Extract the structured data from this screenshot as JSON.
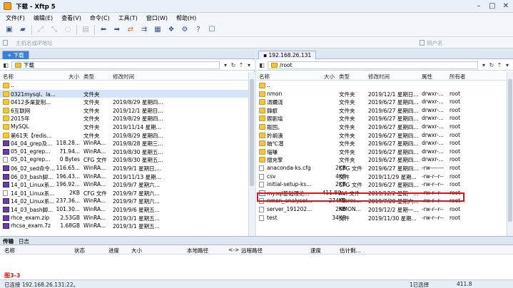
{
  "window": {
    "title": "下载 - Xftp 5"
  },
  "menu": [
    "文件(F)",
    "编辑(E)",
    "查看(V)",
    "命令(C)",
    "工具(T)",
    "窗口(W)",
    "帮助(H)"
  ],
  "address": {
    "host_placeholder": "主机名或IP地址",
    "user_placeholder": "用户名"
  },
  "local": {
    "tab": "下载",
    "path": "下载",
    "columns": {
      "name": "名称",
      "size": "大小",
      "type": "类型",
      "modified": "修改时间"
    },
    "rows": [
      {
        "icon": "up",
        "name": "..",
        "size": "",
        "type": "",
        "modified": ""
      },
      {
        "icon": "dir",
        "name": "0321mysql、la...",
        "size": "",
        "type": "文件夹",
        "modified": ""
      },
      {
        "icon": "dir",
        "name": "0412多渠复制...",
        "size": "",
        "type": "文件夹",
        "modified": "2019/8/29 星期四..."
      },
      {
        "icon": "dir",
        "name": "6互联网",
        "size": "",
        "type": "文件夹",
        "modified": "2019/12/1 星期日..."
      },
      {
        "icon": "dir",
        "name": "2015年",
        "size": "",
        "type": "文件夹",
        "modified": "2019/8/29 星期四..."
      },
      {
        "icon": "dir",
        "name": "MySQL",
        "size": "",
        "type": "文件夹",
        "modified": "2019/11/14 星期..."
      },
      {
        "icon": "dir",
        "name": "第61天【redis...",
        "size": "",
        "type": "文件夹",
        "modified": "2019/8/29 星期四..."
      },
      {
        "icon": "rar",
        "name": "04_04_grep及...",
        "size": "118.28...",
        "type": "WinRA...",
        "modified": "2019/8/28 星期三..."
      },
      {
        "icon": "rar",
        "name": "05_01_egrep...",
        "size": "71.94...",
        "type": "WinRA...",
        "modified": "2019/8/30 星期五..."
      },
      {
        "icon": "file",
        "name": "05_01_egrep...",
        "size": "0 Bytes",
        "type": "CFG 文件",
        "modified": "2019/8/30 星期五..."
      },
      {
        "icon": "rar",
        "name": "06_02_sed命令...",
        "size": "116.65...",
        "type": "WinRA...",
        "modified": "2019/9/1 星期日,..."
      },
      {
        "icon": "rar",
        "name": "06_03_bash脚...",
        "size": "196.43...",
        "type": "WinRA...",
        "modified": "2019/11/13 星期..."
      },
      {
        "icon": "rar",
        "name": "14_01_Linux系...",
        "size": "196.92...",
        "type": "WinRA...",
        "modified": "2019/9/7 星期六..."
      },
      {
        "icon": "file",
        "name": "14_01_Linux系...",
        "size": "2KB",
        "type": "CFG 文件",
        "modified": "2019/9/7 星期六..."
      },
      {
        "icon": "rar",
        "name": "14_02_Linux系...",
        "size": "237.36...",
        "type": "WinRA...",
        "modified": "2019/9/7 星期六..."
      },
      {
        "icon": "rar",
        "name": "14_03_bash脚...",
        "size": "101.30...",
        "type": "WinRA...",
        "modified": "2019/9/6 星期五..."
      },
      {
        "icon": "rar",
        "name": "rhce_exam.zip",
        "size": "2.53GB",
        "type": "WinRA...",
        "modified": "2019/3/1 星期五..."
      },
      {
        "icon": "rar",
        "name": "rhcsa_exam.7z",
        "size": "1.68GB",
        "type": "WinRA...",
        "modified": "2019/3/1 星期五..."
      }
    ]
  },
  "remote": {
    "tab": "192.168.26.131",
    "path": "/root",
    "columns": {
      "name": "名称",
      "size": "大小",
      "type": "类型",
      "modified": "修改时间",
      "perm": "属性",
      "owner": "所有者"
    },
    "rows": [
      {
        "icon": "up",
        "name": "..",
        "size": "",
        "type": "",
        "modified": "",
        "perm": "",
        "owner": ""
      },
      {
        "icon": "dir",
        "name": "nmon",
        "size": "",
        "type": "文件夹",
        "modified": "2019/12/1 星期日...",
        "perm": "drwxr-...",
        "owner": "root"
      },
      {
        "icon": "dir",
        "name": "涓嬭浇",
        "size": "",
        "type": "文件夹",
        "modified": "2019/6/27 星期四...",
        "perm": "drwxr-...",
        "owner": "root"
      },
      {
        "icon": "dir",
        "name": "鍏叡",
        "size": "",
        "type": "文件夹",
        "modified": "2019/6/27 星期四...",
        "perm": "drwxr-...",
        "owner": "root"
      },
      {
        "icon": "dir",
        "name": "鍥剧墖",
        "size": "",
        "type": "文件夹",
        "modified": "2019/6/27 星期四...",
        "perm": "drwxr-...",
        "owner": "root"
      },
      {
        "icon": "dir",
        "name": "鏂囨。",
        "size": "",
        "type": "文件夹",
        "modified": "2019/6/27 星期四...",
        "perm": "drwxr-...",
        "owner": "root"
      },
      {
        "icon": "dir",
        "name": "妗岄潰",
        "size": "",
        "type": "文件夹",
        "modified": "2019/6/27 星期四...",
        "perm": "drwxr-...",
        "owner": "root"
      },
      {
        "icon": "dir",
        "name": "妯℃澘",
        "size": "",
        "type": "文件夹",
        "modified": "2019/6/27 星期四...",
        "perm": "drwxr-...",
        "owner": "root"
      },
      {
        "icon": "dir",
        "name": "瑙嗛",
        "size": "",
        "type": "文件夹",
        "modified": "2019/6/27 星期四...",
        "perm": "drwxr-...",
        "owner": "root"
      },
      {
        "icon": "dir",
        "name": "闊充箰",
        "size": "",
        "type": "文件夹",
        "modified": "2019/6/27 星期四...",
        "perm": "drwxr-...",
        "owner": "root"
      },
      {
        "icon": "file",
        "name": "anaconda-ks.cfg",
        "size": "2KB",
        "type": "CFG 文件",
        "modified": "2019/6/27 星期四...",
        "perm": "-rw-------",
        "owner": "root"
      },
      {
        "icon": "file",
        "name": "csv",
        "size": "4KB",
        "type": "文件",
        "modified": "2019/11/29 星期...",
        "perm": "-rw-r--r--",
        "owner": "root"
      },
      {
        "icon": "file",
        "name": "initial-setup-ks...",
        "size": "2KB",
        "type": "CFG 文件",
        "modified": "2019/6/27 星期四...",
        "perm": "-rw-r--r--",
        "owner": "root"
      },
      {
        "icon": "sql",
        "name": "mysql基础理论...",
        "size": "411.80...",
        "type": "AVI 文件",
        "modified": "2019/12/2 星期一...",
        "perm": "-rw-r--r--",
        "owner": "root"
      },
      {
        "icon": "file",
        "name": "nmon_analyser...",
        "size": "274KB",
        "type": "Micros...",
        "modified": "2019/7/20 星期六...",
        "perm": "-rw-r--r--",
        "owner": "root"
      },
      {
        "icon": "file",
        "name": "server_191202...",
        "size": "2KB",
        "type": "NMON...",
        "modified": "2019/12/2 星期一...",
        "perm": "-rw-r--r--",
        "owner": "root"
      },
      {
        "icon": "file",
        "name": "test",
        "size": "34KB",
        "type": "文件",
        "modified": "2019/11/30 星期...",
        "perm": "-rw-r--r--",
        "owner": "root"
      }
    ]
  },
  "transfer": {
    "tabs": [
      "传输",
      "日志"
    ],
    "columns": [
      "名称",
      "状态",
      "进度",
      "大小",
      "本地路径",
      "<->",
      "远程路径",
      "速度",
      "估计剩..."
    ]
  },
  "figure_label": "图3-3",
  "status": {
    "left": "已连接 192.168.26.131:22。",
    "middle": "1已选择",
    "right": "411.8"
  }
}
